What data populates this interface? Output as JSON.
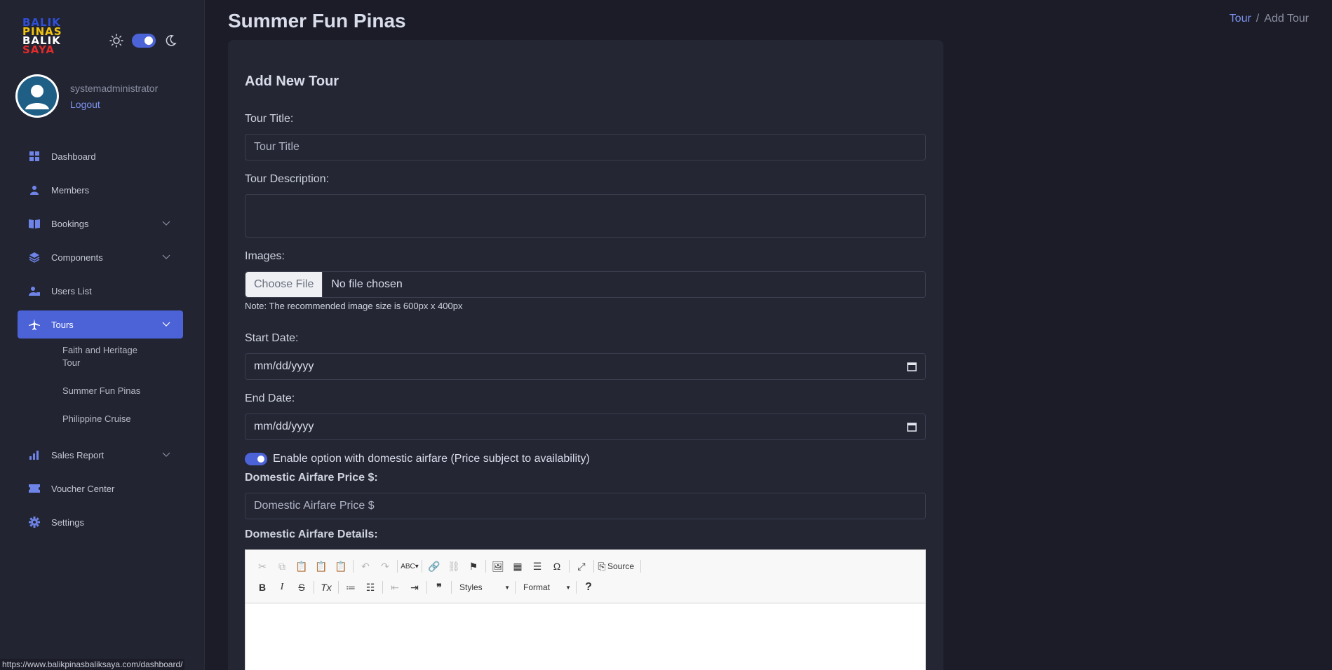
{
  "app": {
    "logo_lines": [
      "BALIK",
      "PINAS",
      "BALIK",
      "SAYA"
    ]
  },
  "theme": {
    "sun_icon": "sun-icon",
    "moon_icon": "moon-icon",
    "dark_mode": true
  },
  "user": {
    "name": "systemadministrator",
    "logout_label": "Logout"
  },
  "sidebar": {
    "items": [
      {
        "label": "Dashboard",
        "icon": "grid-icon"
      },
      {
        "label": "Members",
        "icon": "person-icon"
      },
      {
        "label": "Bookings",
        "icon": "book-icon",
        "expandable": true
      },
      {
        "label": "Components",
        "icon": "layers-icon",
        "expandable": true
      },
      {
        "label": "Users List",
        "icon": "user-lock-icon"
      },
      {
        "label": "Tours",
        "icon": "airplane-icon",
        "expandable": true,
        "active": true
      },
      {
        "label": "Sales Report",
        "icon": "bar-chart-icon",
        "expandable": true
      },
      {
        "label": "Voucher Center",
        "icon": "ticket-icon"
      },
      {
        "label": "Settings",
        "icon": "gear-icon"
      }
    ],
    "tours_sub": [
      "Faith and Heritage Tour",
      "Summer Fun Pinas",
      "Philippine Cruise"
    ]
  },
  "status_url": "https://www.balikpinasbaliksaya.com/dashboard/",
  "header": {
    "title": "Summer Fun Pinas"
  },
  "breadcrumb": {
    "link": "Tour",
    "separator": "/",
    "current": "Add Tour"
  },
  "form": {
    "title": "Add New Tour",
    "tour_title_label": "Tour Title:",
    "tour_title_placeholder": "Tour Title",
    "description_label": "Tour Description:",
    "images_label": "Images:",
    "choose_file": "Choose File",
    "no_file": "No file chosen",
    "note": "Note: The recommended image size is 600px x 400px",
    "start_date_label": "Start Date:",
    "start_date_value": "mm/dd/yyyy",
    "end_date_label": "End Date:",
    "end_date_value": "mm/dd/yyyy",
    "airfare_toggle_label": "Enable option with domestic airfare (Price subject to availability)",
    "airfare_enabled": true,
    "airfare_price_label": "Domestic Airfare Price $:",
    "airfare_price_placeholder": "Domestic Airfare Price $",
    "airfare_details_label": "Domestic Airfare Details:"
  },
  "editor": {
    "source_label": "Source",
    "styles_label": "Styles",
    "format_label": "Format",
    "help_label": "?",
    "omega": "Ω",
    "accent": "#4c63d8"
  }
}
